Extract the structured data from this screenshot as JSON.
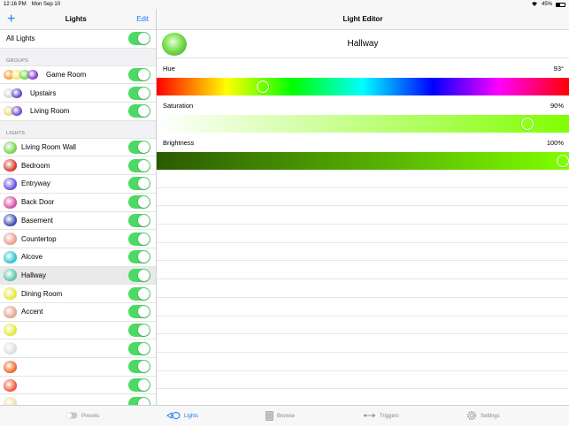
{
  "status": {
    "time": "12:16 PM",
    "date": "Mon Sep 10",
    "battery": "45%"
  },
  "lights_panel": {
    "title": "Lights",
    "add_label": "+",
    "edit_label": "Edit",
    "all_lights_label": "All Lights",
    "groups_header": "GROUPS",
    "groups": [
      {
        "label": "Game Room",
        "colors": [
          "#f2a33a",
          "#f7e36a",
          "#6fdc4a",
          "#8a42d6"
        ]
      },
      {
        "label": "Upstairs",
        "colors": [
          "#d8d8d8",
          "#6b4ccf"
        ]
      },
      {
        "label": "Living Room",
        "colors": [
          "#f0d98a",
          "#7b4fd6"
        ]
      }
    ],
    "lights_header": "LIGHTS",
    "lights": [
      {
        "label": "Living Room Wall",
        "color": "#79d34b"
      },
      {
        "label": "Bedroom",
        "color": "#d53a2f"
      },
      {
        "label": "Entryway",
        "color": "#6a4fd9"
      },
      {
        "label": "Back Door",
        "color": "#d54fa0"
      },
      {
        "label": "Basement",
        "color": "#3d4fb0"
      },
      {
        "label": "Countertop",
        "color": "#ec9c92"
      },
      {
        "label": "Alcove",
        "color": "#2fc4d5"
      },
      {
        "label": "Hallway",
        "color": "#63c4a8",
        "selected": true
      },
      {
        "label": "Dining Room",
        "color": "#e3ea40"
      },
      {
        "label": "Accent",
        "color": "#e6a392"
      },
      {
        "label": "",
        "color": "#e3ea40"
      },
      {
        "label": "",
        "color": "#dedede"
      },
      {
        "label": "",
        "color": "#ee6a2d"
      },
      {
        "label": "",
        "color": "#ef5a3a"
      },
      {
        "label": "",
        "color": "#e9e2b0"
      }
    ]
  },
  "editor": {
    "title": "Light Editor",
    "light_name": "Hallway",
    "hue": {
      "label": "Hue",
      "value_text": "93°",
      "fraction": 0.258
    },
    "saturation": {
      "label": "Saturation",
      "value_text": "90%",
      "fraction": 0.9
    },
    "brightness": {
      "label": "Brightness",
      "value_text": "100%",
      "fraction": 1.0
    }
  },
  "tabbar": {
    "tabs": [
      {
        "label": "Presets",
        "icon": "presets-toggle-icon"
      },
      {
        "label": "Lights",
        "icon": "lights-icon",
        "active": true
      },
      {
        "label": "Browse",
        "icon": "browse-icon"
      },
      {
        "label": "Triggers",
        "icon": "triggers-icon"
      },
      {
        "label": "Settings",
        "icon": "gear-icon"
      }
    ]
  }
}
